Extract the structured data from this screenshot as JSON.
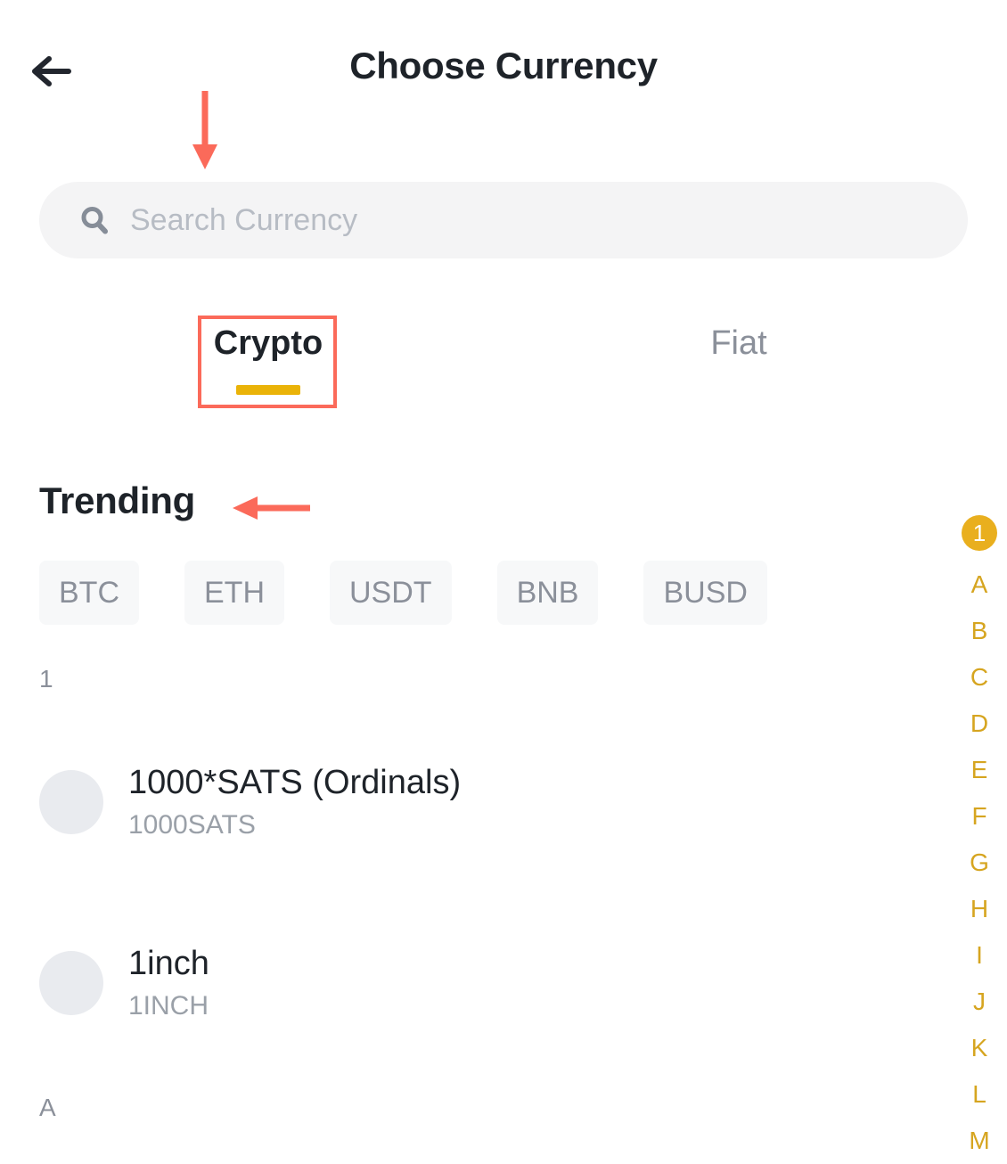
{
  "header": {
    "title": "Choose Currency",
    "back_icon": "arrow-left-icon"
  },
  "search": {
    "icon": "search-icon",
    "placeholder": "Search Currency",
    "value": ""
  },
  "tabs": {
    "items": [
      {
        "label": "Crypto",
        "active": true
      },
      {
        "label": "Fiat",
        "active": false
      }
    ],
    "active_underline_color": "#eab308"
  },
  "trending": {
    "title": "Trending",
    "chips": [
      "BTC",
      "ETH",
      "USDT",
      "BNB",
      "BUSD"
    ]
  },
  "list": {
    "sections": [
      {
        "letter": "1",
        "rows": [
          {
            "name": "1000*SATS (Ordinals)",
            "symbol": "1000SATS"
          },
          {
            "name": "1inch",
            "symbol": "1INCH"
          }
        ]
      },
      {
        "letter": "A",
        "rows": []
      }
    ]
  },
  "alpha_index": {
    "selected": "1",
    "letters": [
      "A",
      "B",
      "C",
      "D",
      "E",
      "F",
      "G",
      "H",
      "I",
      "J",
      "K",
      "L",
      "M"
    ],
    "badge_color": "#e9af1e",
    "letter_color": "#d6a520"
  },
  "annotations": {
    "color": "#fb6a5a",
    "arrow_to_search": "arrow-down-icon",
    "arrow_to_trending": "arrow-left-icon",
    "highlight_box_target": "Crypto"
  }
}
